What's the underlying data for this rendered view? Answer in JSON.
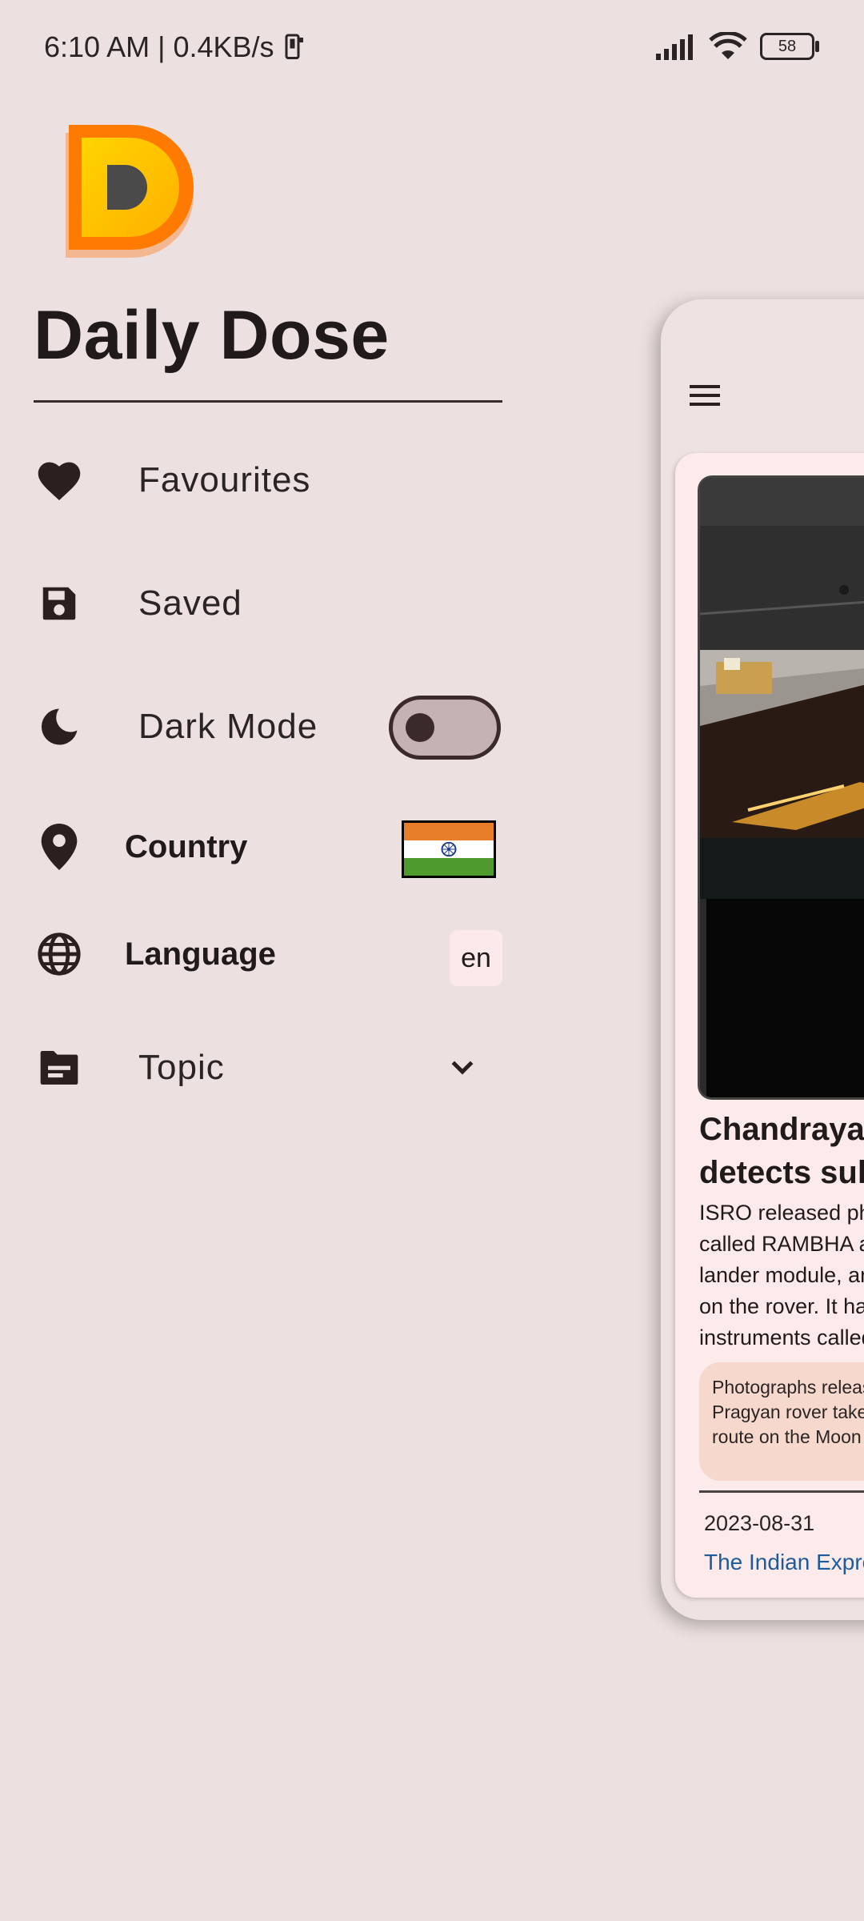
{
  "status_bar": {
    "time_speed": "6:10 AM | 0.4KB/s",
    "battery": "58"
  },
  "drawer": {
    "logo_letter": "D",
    "app_title": "Daily Dose",
    "items": [
      {
        "label": "Favourites",
        "icon": "heart-icon"
      },
      {
        "label": "Saved",
        "icon": "save-icon"
      },
      {
        "label": "Dark Mode",
        "icon": "moon-icon",
        "toggle_on": false
      },
      {
        "label": "Country",
        "icon": "location-pin-icon",
        "country_flag": "india-flag"
      },
      {
        "label": "Language",
        "icon": "globe-icon",
        "value": "en"
      },
      {
        "label": "Topic",
        "icon": "topic-folder-icon"
      }
    ]
  },
  "news_card": {
    "title": "Chandrayaan\ndetects sulphur",
    "description": "ISRO released photos\ncalled RAMBHA and\nlander module, and\non the rover. It has\ninstruments called",
    "caption": "Photographs released\nPragyan rover taken\nroute on the Moon",
    "date": "2023-08-31",
    "source": "The Indian Express"
  },
  "colors": {
    "background": "#ede0e0",
    "card": "#fdeaea",
    "accent_source": "#1e5b9a",
    "toggle_track": "#c5b2b2"
  }
}
